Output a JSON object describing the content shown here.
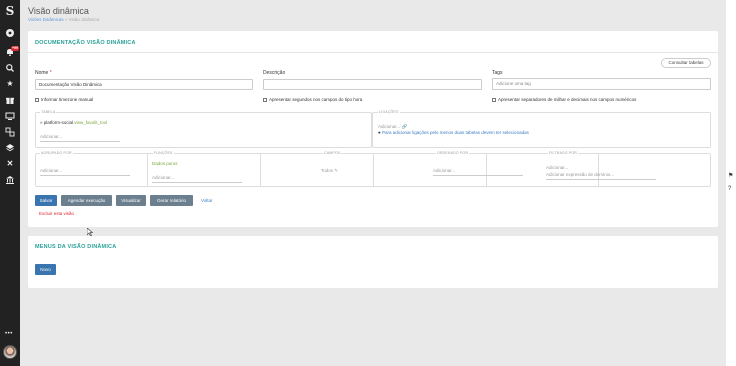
{
  "page": {
    "title": "Visão dinâmica",
    "breadcrumb": {
      "link": "Visões Dinâmicas",
      "sep": " » ",
      "current": "Visão dinâmica"
    }
  },
  "sidebar": {
    "logo": "S",
    "badge": "+99",
    "icons": [
      "circle-menu-icon",
      "notifications-icon",
      "search-icon",
      "star-icon",
      "gift-icon",
      "monitor-icon",
      "share-icon",
      "layers-icon",
      "close-x-icon",
      "bank-icon"
    ],
    "dots": "•••"
  },
  "card1": {
    "title": "DOCUMENTAÇÃO VISÃO DINÂMICA",
    "consult_button": "Consultar tabelas",
    "nome_label": "Nome",
    "nome_required": "*",
    "nome_value": "Documentação Visão Dinâmica",
    "descricao_label": "Descrição",
    "descricao_value": "",
    "tags_label": "Tags",
    "tags_placeholder": "Adicione uma tag",
    "chk_timezone": "Informar timezone manual",
    "chk_seconds": "Apresentar segundos nos campos do tipo hora",
    "chk_separators": "Apresentar separadores de milhar e decimais nos campos numéricos",
    "tabela_label": "TABELA",
    "tabela_prefix": "» platform-social.",
    "tabela_value": "view_favolit_tool",
    "tabela_add": "Adicionar...",
    "ligacoes_label": "LIGAÇÕES",
    "ligacoes_add": "Adicionar...",
    "ligacoes_info": "Para adicionar ligações pelo menos duas tabelas devem ter selecionadas",
    "agrupado_label": "AGRUPADO POR",
    "agrupado_add": "Adicionar...",
    "funcoes_label": "FUNÇÕES",
    "funcoes_value": "Dados puros",
    "funcoes_add": "Adicionar...",
    "campos_label": "CAMPOS",
    "campos_value": "Todos",
    "ordenado_label": "ORDENADO POR",
    "ordenado_add": "Adicionar...",
    "filtrado_label": "FILTRADO POR",
    "filtrado_add": "Adicionar...",
    "filtrado_expr": "Adicionar expressão de domínio...",
    "btn_salvar": "Salvar",
    "btn_agendar": "Agendar execução",
    "btn_visualizar": "Visualizar",
    "btn_relatorio": "Gerar relatório",
    "btn_voltar": "Voltar",
    "excluir": "Excluir esta visão"
  },
  "card2": {
    "title": "MENUS DA VISÃO DINÂMICA",
    "btn_novo": "Novo"
  },
  "colors": {
    "accent_teal": "#2aa198",
    "primary_blue": "#3a75b0",
    "danger": "#d9272e",
    "sidebar_bg": "#222222"
  }
}
